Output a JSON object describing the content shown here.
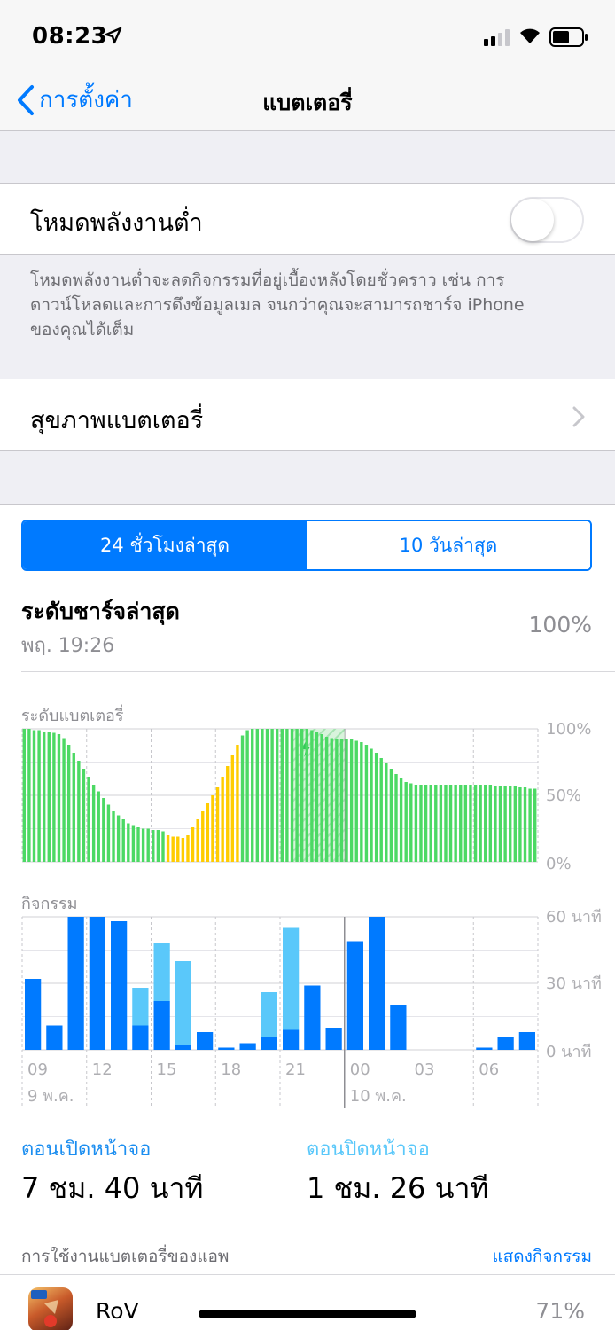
{
  "status_bar": {
    "time": "08:23",
    "icons": [
      "location-arrow-icon",
      "signal-icon",
      "wifi-icon",
      "battery-icon"
    ]
  },
  "nav": {
    "back_label": "การตั้งค่า",
    "title": "แบตเตอรี่"
  },
  "low_power": {
    "label": "โหมดพลังงานต่ำ",
    "enabled": false,
    "footer_line1": "โหมดพลังงานต่ำจะลดกิจกรรมที่อยู่เบื้องหลังโดยชั่วคราว เช่น การ",
    "footer_line2": "ดาวน์โหลดและการดึงข้อมูลเมล จนกว่าคุณจะสามารถชาร์จ iPhone",
    "footer_line3": "ของคุณได้เต็ม"
  },
  "battery_health": {
    "label": "สุขภาพแบตเตอรี่"
  },
  "segments": {
    "active": "24 ชั่วโมงล่าสุด",
    "inactive": "10 วันล่าสุด"
  },
  "last_charge": {
    "title": "ระดับชาร์จล่าสุด",
    "time": "พฤ. 19:26",
    "value": "100%"
  },
  "colors": {
    "accent": "#007aff",
    "battery_green": "#4cd964",
    "charging_yellow": "#ffcc00",
    "screen_on": "#007aff",
    "screen_off": "#5ac8fa"
  },
  "chart_data": [
    {
      "type": "bar",
      "title": "ระดับแบตเตอรี่",
      "y_ticks": [
        "100%",
        "50%",
        "0%"
      ],
      "ylim": [
        0,
        100
      ],
      "grid": true,
      "x_unit": "hour",
      "charging_interval": [
        12.5,
        15.0
      ],
      "values": [
        100,
        100,
        99,
        99,
        98,
        98,
        97,
        96,
        93,
        88,
        82,
        76,
        70,
        64,
        58,
        53,
        48,
        43,
        38,
        35,
        32,
        29,
        27,
        26,
        25,
        25,
        24,
        24,
        23,
        20,
        19,
        19,
        18,
        20,
        26,
        32,
        38,
        44,
        50,
        56,
        64,
        72,
        80,
        88,
        95,
        99,
        100,
        100,
        100,
        100,
        100,
        100,
        100,
        100,
        100,
        100,
        100,
        100,
        99,
        98,
        96,
        94,
        93,
        92,
        92,
        92,
        92,
        91,
        90,
        88,
        85,
        82,
        78,
        74,
        70,
        66,
        63,
        60,
        59,
        58,
        58,
        58,
        58,
        58,
        58,
        58,
        58,
        58,
        58,
        58,
        58,
        58,
        58,
        58,
        58,
        57,
        57,
        57,
        57,
        57,
        56,
        56,
        55,
        55
      ],
      "charging_flags": [
        0,
        0,
        0,
        0,
        0,
        0,
        0,
        0,
        0,
        0,
        0,
        0,
        0,
        0,
        0,
        0,
        0,
        0,
        0,
        0,
        0,
        0,
        0,
        0,
        0,
        0,
        0,
        0,
        0,
        1,
        1,
        1,
        1,
        1,
        1,
        1,
        1,
        1,
        1,
        1,
        1,
        1,
        1,
        1,
        0,
        0,
        0,
        0,
        0,
        0,
        0,
        0,
        0,
        0,
        0,
        0,
        0,
        0,
        0,
        0,
        0,
        0,
        0,
        0,
        0,
        0,
        0,
        0,
        0,
        0,
        0,
        0,
        0,
        0,
        0,
        0,
        0,
        0,
        0,
        0,
        0,
        0,
        0,
        0,
        0,
        0,
        0,
        0,
        0,
        0,
        0,
        0,
        0,
        0,
        0,
        0,
        0,
        0,
        0,
        0,
        0,
        0,
        0,
        0
      ]
    },
    {
      "type": "bar",
      "title": "กิจกรรม",
      "y_ticks": [
        "60 นาที",
        "30 นาที",
        "0 นาที"
      ],
      "ylim": [
        0,
        60
      ],
      "grid": true,
      "x_ticks": [
        "09",
        "12",
        "15",
        "18",
        "21",
        "00",
        "03",
        "06"
      ],
      "date_labels": [
        "9 พ.ค.",
        "10 พ.ค."
      ],
      "series": [
        {
          "name": "ตอนเปิดหน้าจอ",
          "values": [
            32,
            11,
            60,
            60,
            58,
            11,
            22,
            2,
            8,
            1,
            3,
            6,
            9,
            29,
            10,
            49,
            60,
            20,
            0,
            0,
            0,
            1,
            6,
            8
          ]
        },
        {
          "name": "ตอนปิดหน้าจอ",
          "values": [
            0,
            0,
            0,
            0,
            0,
            17,
            26,
            38,
            0,
            0,
            0,
            20,
            46,
            0,
            0,
            0,
            0,
            0,
            0,
            0,
            0,
            0,
            0,
            0
          ]
        }
      ]
    }
  ],
  "screen_time": {
    "on_label": "ตอนเปิดหน้าจอ",
    "on_value": "7 ชม. 40 นาที",
    "off_label": "ตอนปิดหน้าจอ",
    "off_value": "1 ชม. 26 นาที"
  },
  "app_usage": {
    "header": "การใช้งานแบตเตอรี่ของแอพ",
    "show_activity": "แสดงกิจกรรม",
    "apps": [
      {
        "name": "RoV",
        "percent": "71%",
        "icon": "rov-app-icon"
      }
    ]
  }
}
